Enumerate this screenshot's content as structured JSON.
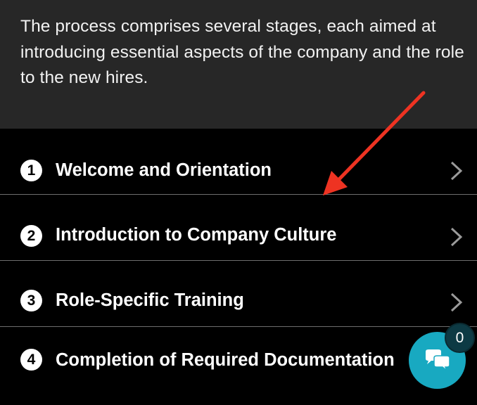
{
  "intro": {
    "text": "The process comprises several stages, each aimed at introducing essential aspects of the company and the role to the new hires."
  },
  "steps": [
    {
      "number": "1",
      "label": "Welcome and Orientation",
      "has_chevron": true
    },
    {
      "number": "2",
      "label": "Introduction to Company Culture",
      "has_chevron": true
    },
    {
      "number": "3",
      "label": "Role-Specific Training",
      "has_chevron": true
    },
    {
      "number": "4",
      "label": "Completion of Required Documentation",
      "has_chevron": false
    }
  ],
  "chat": {
    "icon": "chat-bubbles-icon",
    "badge_count": "0",
    "color": "#18a9c1"
  },
  "annotation": {
    "icon": "red-arrow-icon",
    "color": "#ee3322"
  }
}
